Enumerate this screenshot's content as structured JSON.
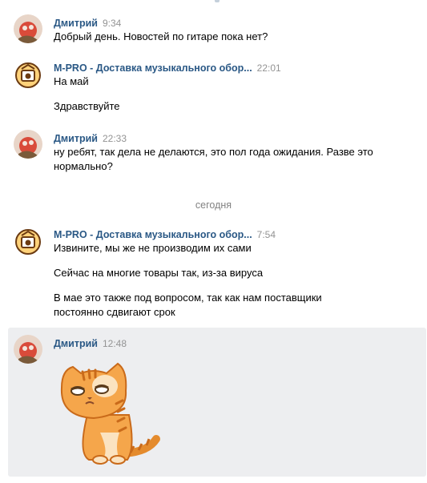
{
  "messages": [
    {
      "author": "Дмитрий",
      "time": "9:34",
      "lines": [
        "Добрый день. Новостей по гитаре пока нет?"
      ]
    },
    {
      "author": "M-PRO - Доставка музыкального обор...",
      "time": "22:01",
      "lines": [
        "На май",
        "Здравствуйте"
      ]
    },
    {
      "author": "Дмитрий",
      "time": "22:33",
      "lines": [
        "ну ребят, так дела не делаются, это пол года ожидания. Разве это",
        "нормально?"
      ]
    },
    {
      "date_separator": "сегодня"
    },
    {
      "author": "M-PRO - Доставка музыкального обор...",
      "time": "7:54",
      "lines": [
        "Извините, мы же не производим их сами",
        "Сейчас на многие товары так, из-за вируса",
        "В мае это также под вопросом, так как нам поставщики",
        "постоянно сдвигают срок"
      ]
    },
    {
      "author": "Дмитрий",
      "time": "12:48",
      "sticker": "sad-orange-cat-sticker"
    }
  ],
  "colors": {
    "author": "#2a5885",
    "time": "#939393",
    "highlight": "#edeef0",
    "separator": "#828282"
  },
  "icons": {
    "user_avatar": "cat-avatar-icon",
    "shop_avatar": "guitar-amp-logo-icon"
  }
}
